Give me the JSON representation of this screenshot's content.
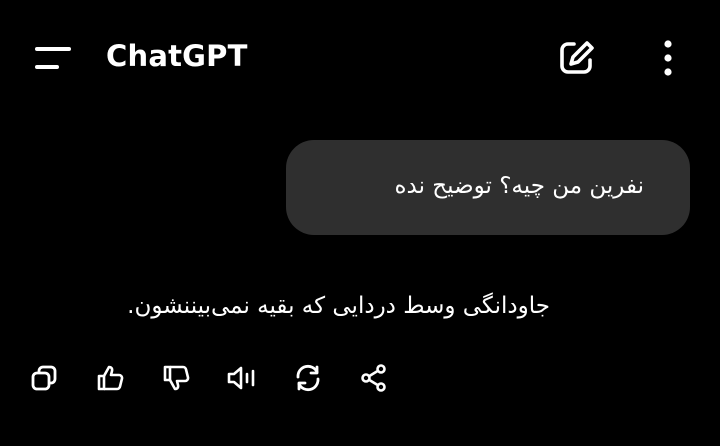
{
  "header": {
    "title": "ChatGPT",
    "icons": {
      "menu": "menu-icon",
      "new_chat": "edit-icon",
      "more": "more-vertical-icon"
    }
  },
  "conversation": {
    "user_message": "نفرین من چیه؟ توضیح نده",
    "assistant_message": "جاودانگی وسط دردایی که بقیه نمی‌بیننشون."
  },
  "message_actions": [
    {
      "icon": "copy-icon"
    },
    {
      "icon": "thumbs-up-icon"
    },
    {
      "icon": "thumbs-down-icon"
    },
    {
      "icon": "read-aloud-icon"
    },
    {
      "icon": "regenerate-icon"
    },
    {
      "icon": "share-icon"
    }
  ],
  "colors": {
    "background": "#000000",
    "bubble": "#2f2f2f",
    "text": "#ffffff"
  }
}
